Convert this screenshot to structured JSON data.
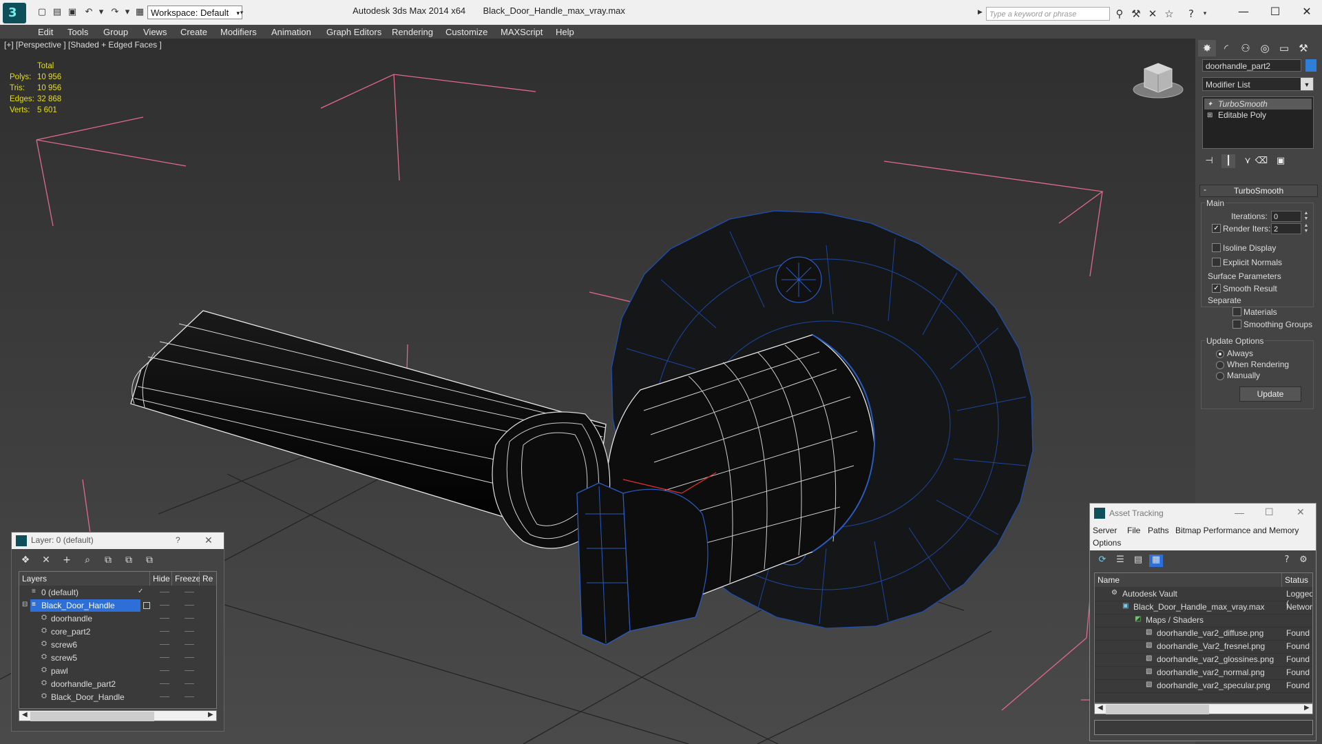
{
  "titlebar": {
    "workspace": "Workspace: Default",
    "app_title": "Autodesk 3ds Max  2014 x64",
    "file_title": "Black_Door_Handle_max_vray.max",
    "search_placeholder": "Type a keyword or phrase",
    "minimize": "—",
    "maximize": "☐",
    "close": "✕"
  },
  "menus": [
    "Edit",
    "Tools",
    "Group",
    "Views",
    "Create",
    "Modifiers",
    "Animation",
    "Graph Editors",
    "Rendering",
    "Customize",
    "MAXScript",
    "Help"
  ],
  "viewport": {
    "label": "[+] [Perspective ] [Shaded + Edged Faces ]",
    "stats_header": "Total",
    "stats": [
      {
        "label": "Polys:",
        "value": "10 956"
      },
      {
        "label": "Tris:",
        "value": "10 956"
      },
      {
        "label": "Edges:",
        "value": "32 868"
      },
      {
        "label": "Verts:",
        "value": "5 601"
      }
    ]
  },
  "command_panel": {
    "object_name": "doorhandle_part2",
    "object_color": "#2f7fd8",
    "modifier_list": "Modifier List",
    "stack": [
      "TurboSmooth",
      "Editable Poly"
    ],
    "rollout": "TurboSmooth",
    "main_label": "Main",
    "iterations_label": "Iterations:",
    "iterations_value": "0",
    "render_iters_label": "Render Iters:",
    "render_iters_value": "2",
    "isoline": "Isoline Display",
    "explicit_normals": "Explicit Normals",
    "surface_params": "Surface Parameters",
    "smooth_result": "Smooth Result",
    "separate": "Separate",
    "materials": "Materials",
    "smoothing_groups": "Smoothing Groups",
    "update_options": "Update Options",
    "always": "Always",
    "when_rendering": "When Rendering",
    "manually": "Manually",
    "update": "Update"
  },
  "layer_dialog": {
    "title": "Layer: 0 (default)",
    "help": "?",
    "close": "✕",
    "columns": [
      "Layers",
      "Hide",
      "Freeze",
      "Re"
    ],
    "rows": [
      {
        "name": "0 (default)",
        "level": 1
      },
      {
        "name": "Black_Door_Handle",
        "level": 1
      },
      {
        "name": "doorhandle",
        "level": 2
      },
      {
        "name": "core_part2",
        "level": 2
      },
      {
        "name": "screw6",
        "level": 2
      },
      {
        "name": "screw5",
        "level": 2
      },
      {
        "name": "pawl",
        "level": 2
      },
      {
        "name": "doorhandle_part2",
        "level": 2
      },
      {
        "name": "Black_Door_Handle",
        "level": 2
      }
    ]
  },
  "asset_tracking": {
    "title": "Asset Tracking",
    "menu": [
      "Server",
      "File",
      "Paths",
      "Bitmap Performance and Memory",
      "Options"
    ],
    "columns": [
      "Name",
      "Status"
    ],
    "rows": [
      {
        "name": "Autodesk Vault",
        "status": "Logged (",
        "level": 1
      },
      {
        "name": "Black_Door_Handle_max_vray.max",
        "status": "Network",
        "level": 2
      },
      {
        "name": "Maps / Shaders",
        "status": "",
        "level": 3
      },
      {
        "name": "doorhandle_var2_diffuse.png",
        "status": "Found",
        "level": 4
      },
      {
        "name": "doorhandle_Var2_fresnel.png",
        "status": "Found",
        "level": 4
      },
      {
        "name": "doorhandle_var2_glossines.png",
        "status": "Found",
        "level": 4
      },
      {
        "name": "doorhandle_var2_normal.png",
        "status": "Found",
        "level": 4
      },
      {
        "name": "doorhandle_var2_specular.png",
        "status": "Found",
        "level": 4
      }
    ]
  }
}
